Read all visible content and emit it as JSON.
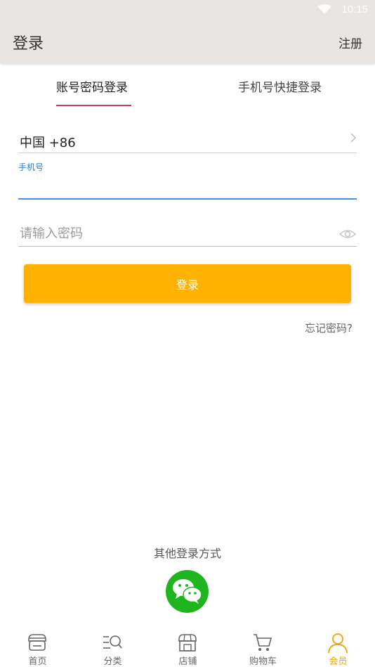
{
  "status_bar": {
    "time": "10:15"
  },
  "app_bar": {
    "title": "登录",
    "register_label": "注册"
  },
  "tabs": [
    {
      "label": "账号密码登录",
      "active": true
    },
    {
      "label": "手机号快捷登录",
      "active": false
    }
  ],
  "form": {
    "country_code": "中国 +86",
    "phone_label": "手机号",
    "phone_value": "",
    "password_placeholder": "请输入密码",
    "login_label": "登录",
    "forgot_label": "忘记密码?"
  },
  "other_login": {
    "label": "其他登录方式",
    "wechat_icon": "wechat-icon"
  },
  "bottom_nav": {
    "items": [
      {
        "label": "首页",
        "icon": "home-store-icon",
        "active": false
      },
      {
        "label": "分类",
        "icon": "category-search-icon",
        "active": false
      },
      {
        "label": "店铺",
        "icon": "shop-icon",
        "active": false
      },
      {
        "label": "购物车",
        "icon": "cart-icon",
        "active": false
      },
      {
        "label": "会员",
        "icon": "member-person-icon",
        "active": true
      }
    ]
  },
  "colors": {
    "accent": "#ffb300",
    "tab_underline": "#d4375a",
    "focus_blue": "#2f7ed8",
    "wechat_green": "#1fb51f",
    "nav_active": "#f5a300",
    "header_bg": "#e8e5e3"
  }
}
